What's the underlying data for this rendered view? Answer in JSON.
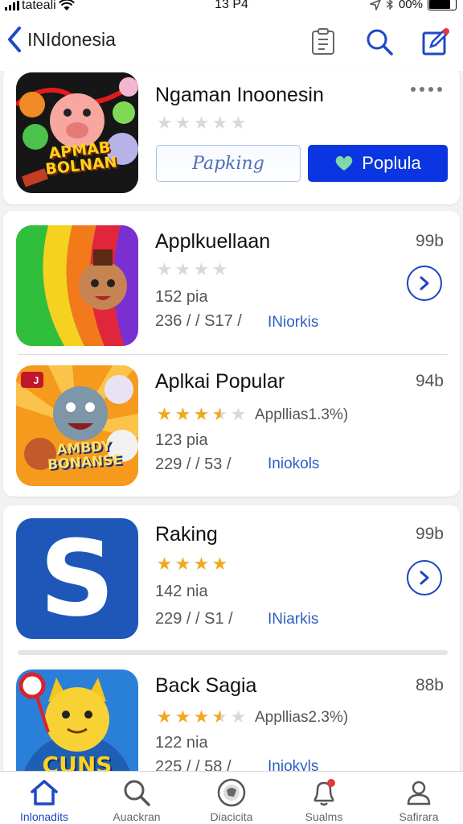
{
  "status": {
    "carrier": "tateali",
    "time": "13 P4",
    "battery": "00%"
  },
  "nav": {
    "back_label": "INIdonesia"
  },
  "featured": {
    "title": "Ngaman Inoonesin",
    "icon_text_1": "APMAB",
    "icon_text_2": "BOLNAN",
    "outline_button": "Papking",
    "primary_button": "Poplula"
  },
  "apps": [
    {
      "title": "Applkuellaan",
      "size": "99b",
      "stars": 0,
      "rating_text": "",
      "meta1": "152 pia",
      "meta2": "236 / / S17  /",
      "link": "INiorkis",
      "action": "chevron-right"
    },
    {
      "title": "Aplkai Popular",
      "size": "94b",
      "stars": 3.5,
      "rating_text": "Appllias1.3%)",
      "meta1": "123 pia",
      "meta2": "229 / / 53  /",
      "link": "Iniokols",
      "icon_text_1": "AMBDY",
      "icon_text_2": "BONANSE",
      "icon_badge": "J"
    },
    {
      "title": "Raking",
      "size": "99b",
      "stars": 4,
      "rating_text": "",
      "meta1": "142 nia",
      "meta2": "229 / / S1  /",
      "link": "INiarkis",
      "action": "chevron-right",
      "icon_letter": "S"
    },
    {
      "title": "Back Sagia",
      "size": "88b",
      "stars": 3.5,
      "rating_text": "Appllias2.3%)",
      "meta1": "122 nia",
      "meta2": "225 / / 58  /",
      "link": "Iniokyls",
      "icon_text_1": "CUNS"
    }
  ],
  "tabs": [
    {
      "label": "Inlonadits",
      "icon": "home-icon",
      "active": true
    },
    {
      "label": "Auackran",
      "icon": "search-icon",
      "active": false
    },
    {
      "label": "Diacicita",
      "icon": "globe-icon",
      "active": false
    },
    {
      "label": "Sualms",
      "icon": "bell-icon",
      "active": false
    },
    {
      "label": "Safirara",
      "icon": "person-icon",
      "active": false
    }
  ],
  "colors": {
    "accent": "#1f47c7",
    "primary_button": "#0a35e0",
    "star": "#f2a81f"
  }
}
